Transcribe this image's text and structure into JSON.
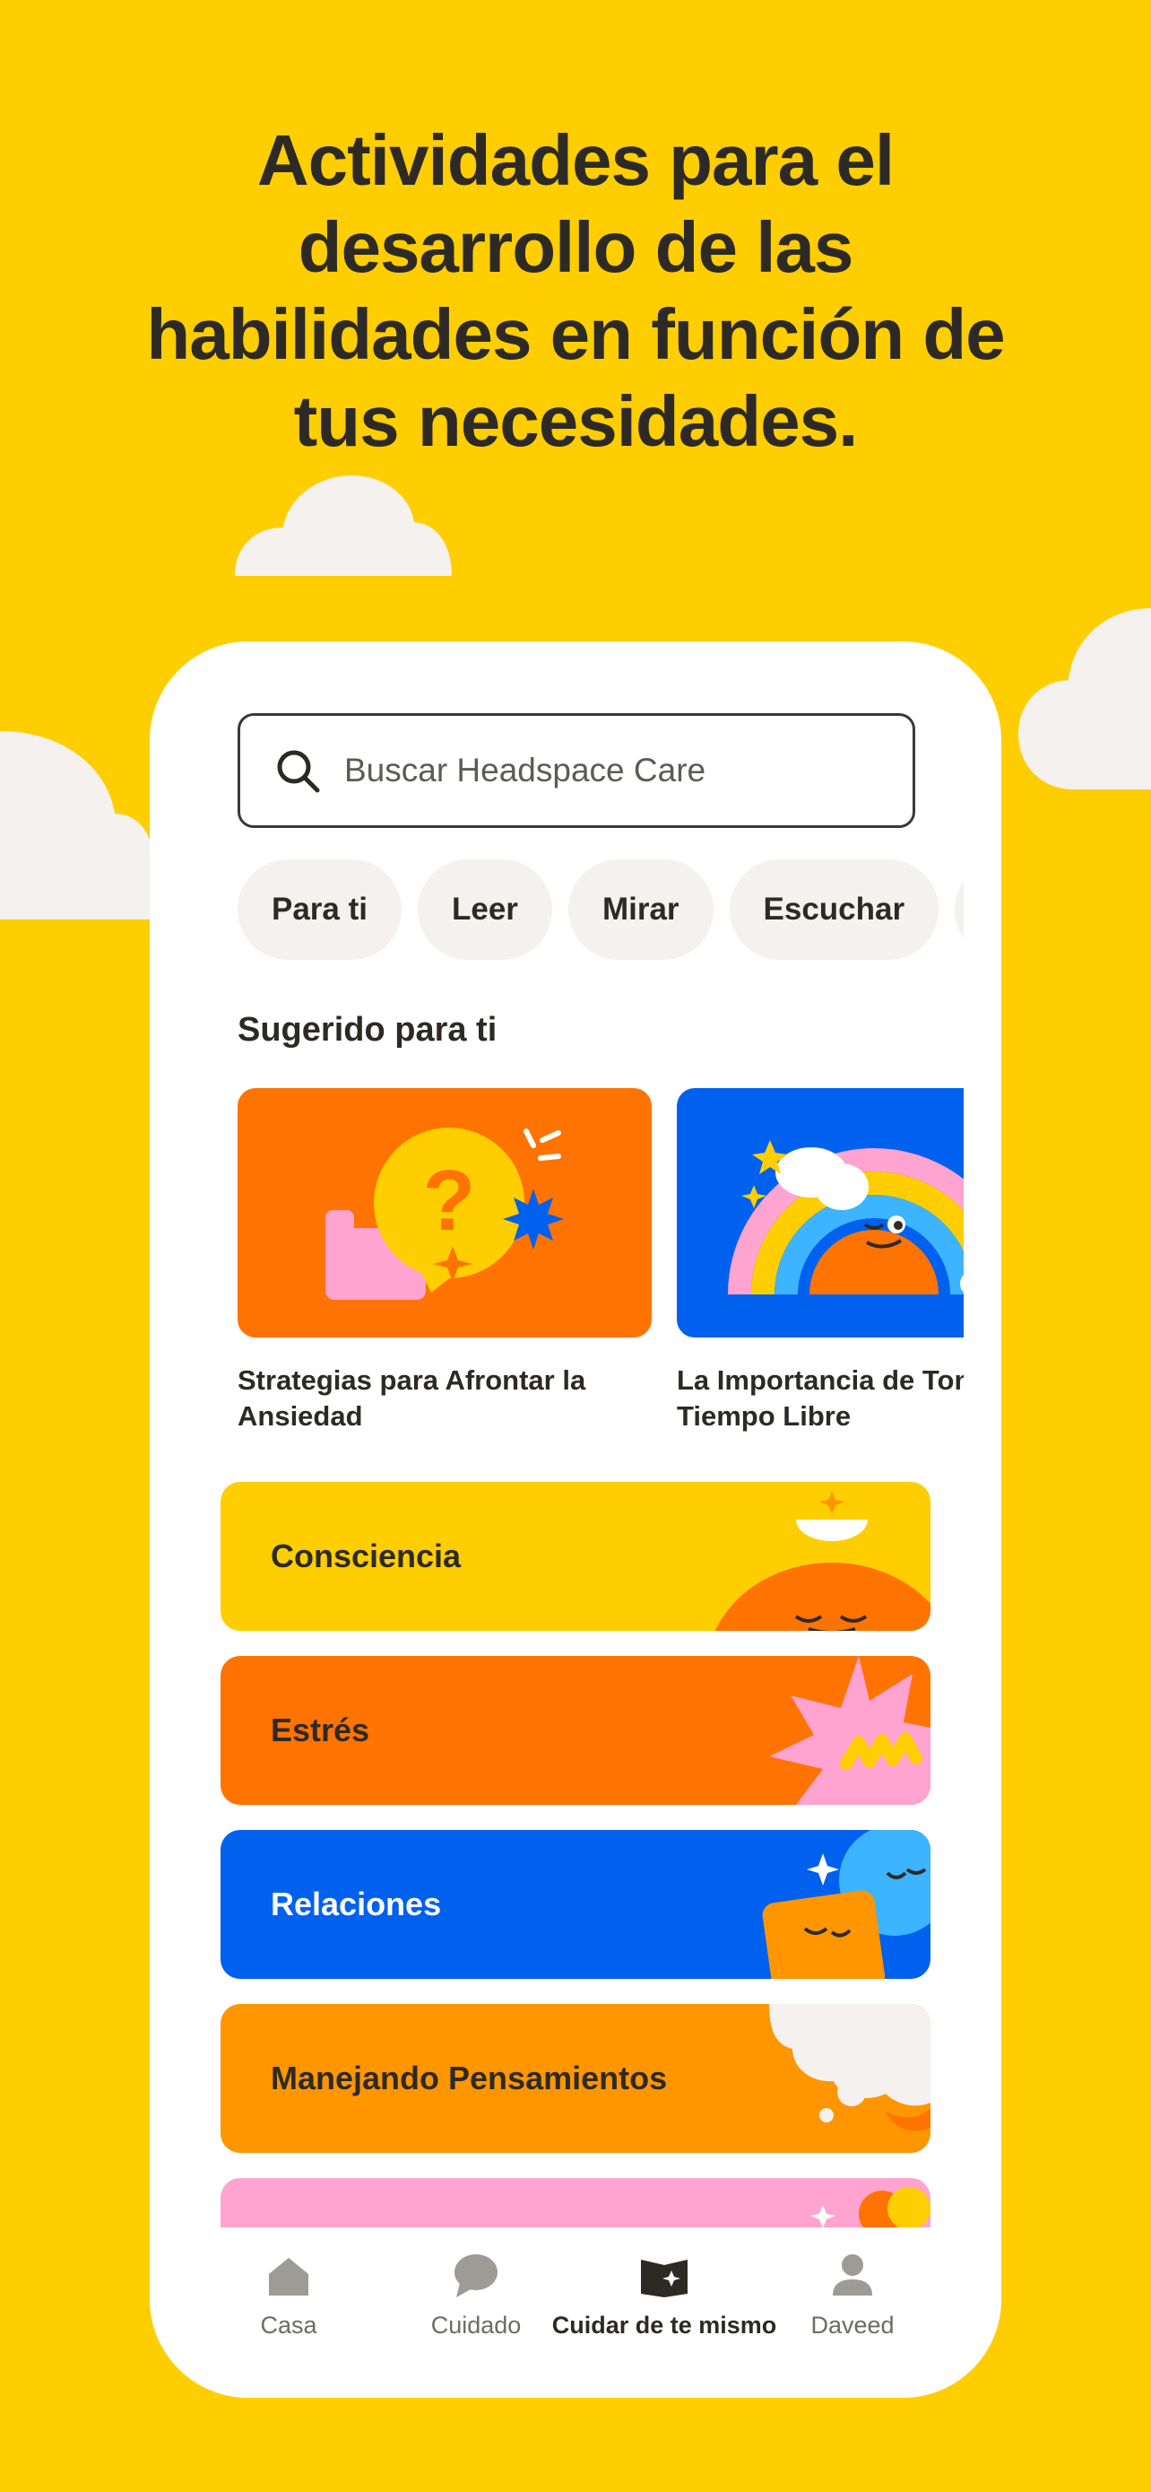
{
  "headline": {
    "lines": [
      "Actividades para el",
      "desarrollo de las",
      "habilidades en función de",
      "tus necesidades."
    ]
  },
  "search": {
    "placeholder": "Buscar Headspace Care",
    "icon": "search-icon"
  },
  "chips": [
    "Para ti",
    "Leer",
    "Mirar",
    "Escuchar"
  ],
  "suggested": {
    "title": "Sugerido para ti",
    "cards": [
      {
        "caption": "Strategias para Afrontar la\nAnsiedad",
        "color": "#FF7300"
      },
      {
        "caption": "La Importancia de Tom\nTiempo Libre",
        "color": "#0061EF"
      }
    ]
  },
  "topics": [
    {
      "label": "Consciencia",
      "color": "#FFCE00",
      "text_color": "#2D2A26"
    },
    {
      "label": "Estrés",
      "color": "#FF7300",
      "text_color": "#2D2A26"
    },
    {
      "label": "Relaciones",
      "color": "#0061EF",
      "text_color": "#FFFFFF"
    },
    {
      "label": "Manejando Pensamientos",
      "color": "#FF9600",
      "text_color": "#2D2A26"
    },
    {
      "label": "",
      "color": "#FFA3D1",
      "text_color": "#2D2A26"
    }
  ],
  "nav": {
    "items": [
      {
        "label": "Casa",
        "icon": "home-icon",
        "active": false
      },
      {
        "label": "Cuidado",
        "icon": "chat-bubble-icon",
        "active": false
      },
      {
        "label": "Cuidar de te mismo",
        "icon": "open-book-icon",
        "active": true
      },
      {
        "label": "Daveed",
        "icon": "profile-icon",
        "active": false
      }
    ]
  },
  "colors": {
    "background": "#FFCE00",
    "text": "#2D2A26",
    "cloud": "#F4F1EE"
  }
}
